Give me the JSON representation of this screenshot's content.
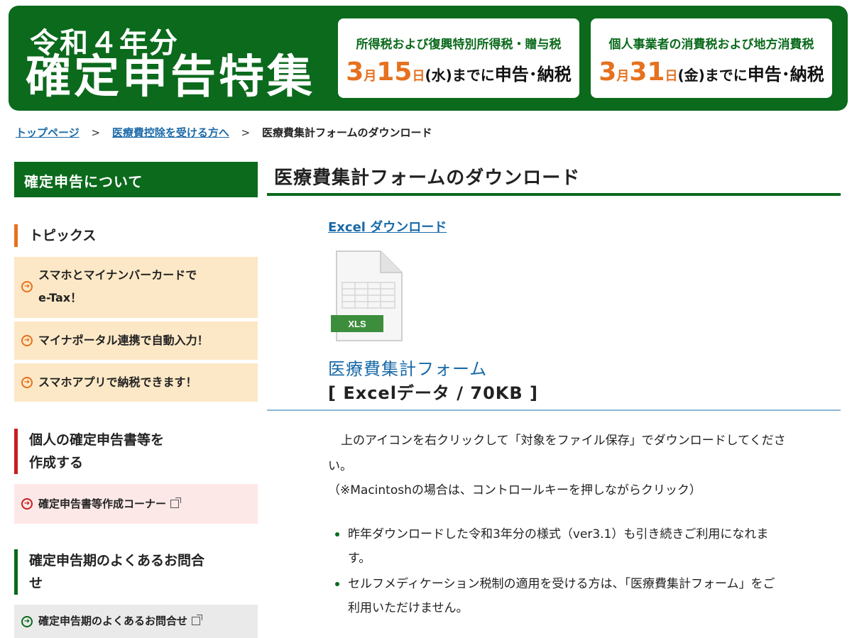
{
  "banner": {
    "year": "令和４年分",
    "title": "確定申告特集",
    "deadlines": [
      {
        "tax": "所得税および復興特別所得税・贈与税",
        "month": "3",
        "month_unit": "月",
        "day": "15",
        "day_unit": "日",
        "weekday": "(水)",
        "until": "までに",
        "action": "申告･納税"
      },
      {
        "tax": "個人事業者の消費税および地方消費税",
        "month": "3",
        "month_unit": "月",
        "day": "31",
        "day_unit": "日",
        "weekday": "(金)",
        "until": "までに",
        "action": "申告･納税"
      }
    ]
  },
  "breadcrumb": {
    "items": [
      "トップページ",
      "医療費控除を受ける方へ"
    ],
    "separator": ">",
    "current": "医療費集計フォームのダウンロード"
  },
  "sidebar": {
    "header": "確定申告について",
    "sections": [
      {
        "title": "トピックス",
        "items": [
          "スマホとマイナンバーカードで",
          "e-Tax！",
          "マイナポータル連携で自動入力！",
          "スマホアプリで納税できます！"
        ]
      },
      {
        "title_line1": "個人の確定申告書等を",
        "title_line2": "作成する",
        "link": "確定申告書等作成コーナー"
      },
      {
        "title_line1": "確定申告期のよくあるお問合",
        "title_line2": "せ",
        "link": "確定申告期のよくあるお問合せ"
      }
    ]
  },
  "main": {
    "title": "医療費集計フォームのダウンロード",
    "download_link": "Excel ダウンロード",
    "file_icon_label": "XLS",
    "form_name": "医療費集計フォーム",
    "form_meta": "[ Excelデータ / 70KB ]",
    "instruction_line1": "上のアイコンを右クリックして「対象をファイル保存」でダウンロードしてくださ",
    "instruction_line2": "い。",
    "note": "（※Macintoshの場合は、コントロールキーを押しながらクリック）",
    "bullets": [
      {
        "line1": "昨年ダウンロードした令和3年分の様式（ver3.1）も引き続きご利用になれま",
        "line2": "す。"
      },
      {
        "line1": "セルフメディケーション税制の適用を受ける方は、「医療費集計フォーム」をご",
        "line2": "利用いただけません。"
      }
    ]
  },
  "colors": {
    "brand_green": "#0b6a1c",
    "accent_orange": "#e6711f",
    "link_blue": "#1a6aa8",
    "accent_red": "#c81e1e"
  },
  "icons": [
    "arrow-circle-icon",
    "external-link-icon",
    "xls-file-icon"
  ]
}
